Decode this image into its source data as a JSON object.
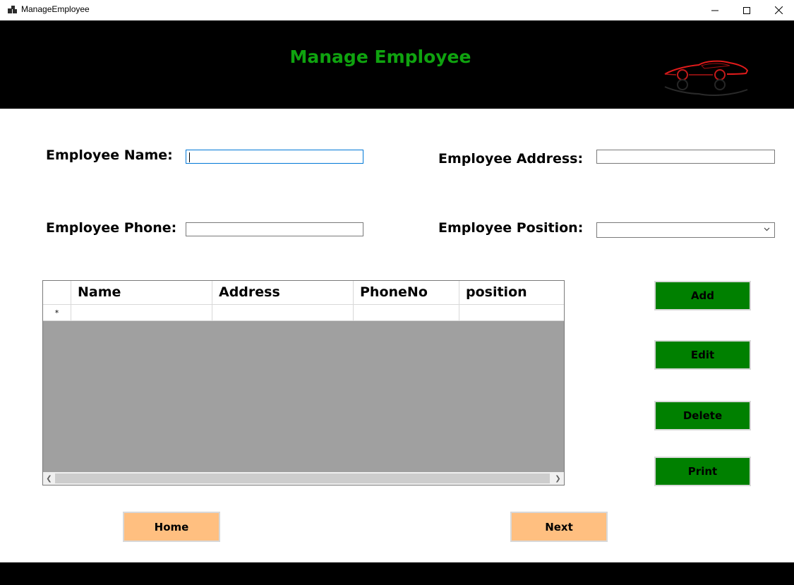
{
  "window": {
    "title": "ManageEmployee"
  },
  "header": {
    "title": "Manage Employee"
  },
  "form": {
    "name_label": "Employee Name:",
    "name_value": "",
    "address_label": "Employee Address:",
    "address_value": "",
    "phone_label": "Employee Phone:",
    "phone_value": "",
    "position_label": "Employee Position:",
    "position_value": ""
  },
  "grid": {
    "columns": [
      "Name",
      "Address",
      "PhoneNo",
      "position"
    ],
    "new_row_marker": "*"
  },
  "actions": {
    "add": "Add",
    "edit": "Edit",
    "delete": "Delete",
    "print": "Print"
  },
  "nav": {
    "home": "Home",
    "next": "Next"
  },
  "colors": {
    "header_bg": "#000000",
    "title": "#0fa30f",
    "action_button": "#008000",
    "nav_button": "#ffbf80",
    "grid_bg": "#a0a0a0"
  }
}
